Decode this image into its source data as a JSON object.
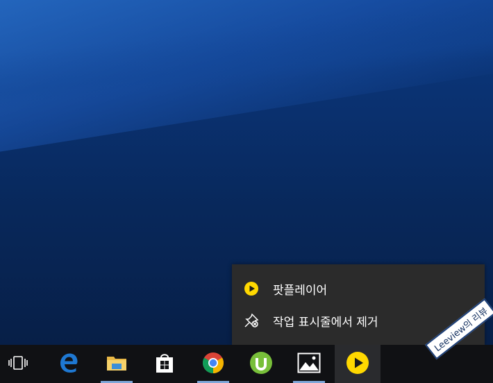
{
  "context_menu": {
    "app_item": {
      "label": "팟플레이어",
      "icon": "potplayer-icon"
    },
    "unpin_item": {
      "label": "작업 표시줄에서 제거",
      "icon": "unpin-icon"
    }
  },
  "taskbar": {
    "buttons": [
      {
        "name": "task-view",
        "icon": "task-view-icon"
      },
      {
        "name": "edge",
        "icon": "edge-icon"
      },
      {
        "name": "file-explorer",
        "icon": "folder-icon"
      },
      {
        "name": "store",
        "icon": "store-icon"
      },
      {
        "name": "chrome",
        "icon": "chrome-icon"
      },
      {
        "name": "utorrent",
        "icon": "utorrent-icon"
      },
      {
        "name": "photos",
        "icon": "photos-icon"
      },
      {
        "name": "potplayer",
        "icon": "potplayer-icon"
      }
    ]
  },
  "watermark": {
    "text": "Leeview의 리뷰"
  },
  "colors": {
    "accent_yellow": "#ffd800",
    "menu_bg": "#2b2b2b",
    "taskbar_bg": "#101114",
    "edge_blue": "#1e78d2"
  }
}
